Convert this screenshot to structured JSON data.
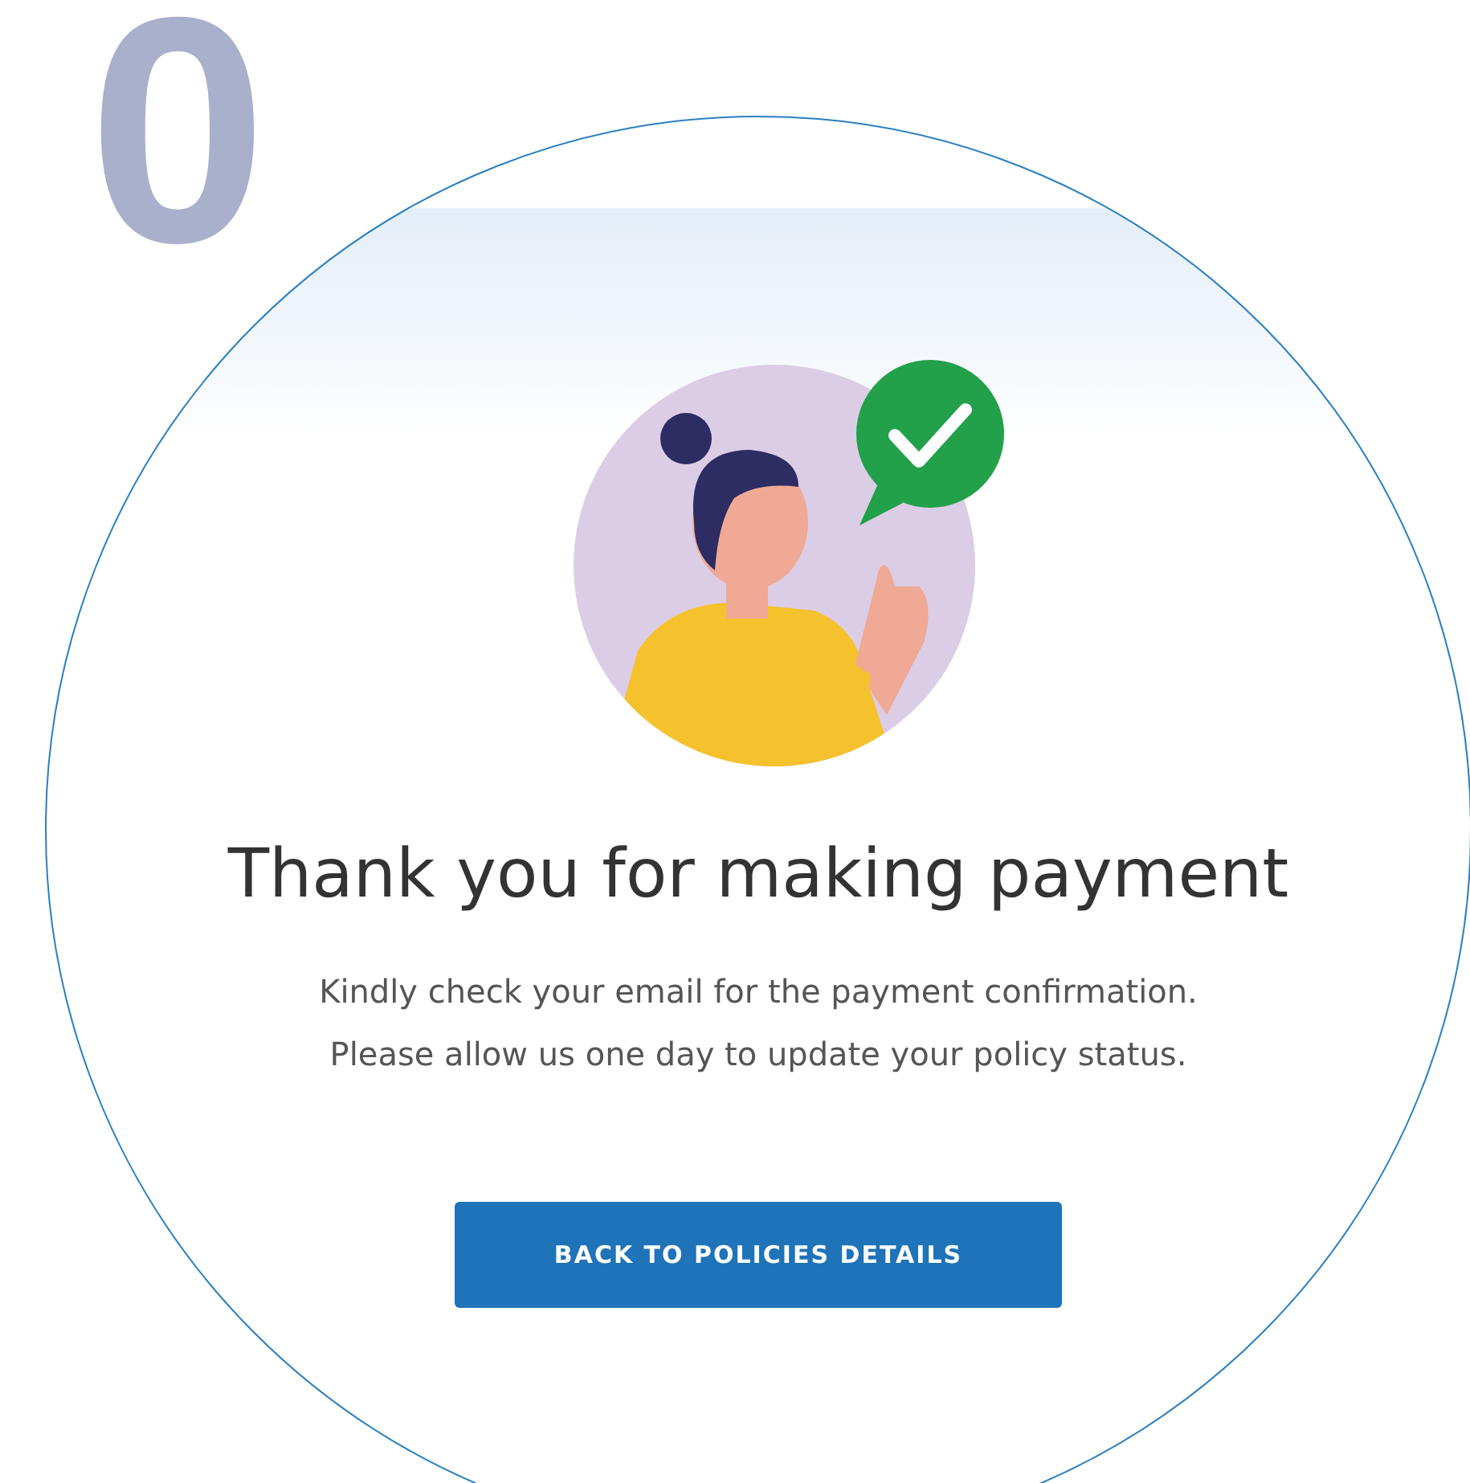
{
  "step_number": "0",
  "screen": {
    "title": "Thank you for making payment",
    "message": [
      "Kindly check your email for the payment confirmation.",
      "Please allow us one day to update your policy status."
    ],
    "button": "BACK TO POLICIES DETAILS"
  }
}
